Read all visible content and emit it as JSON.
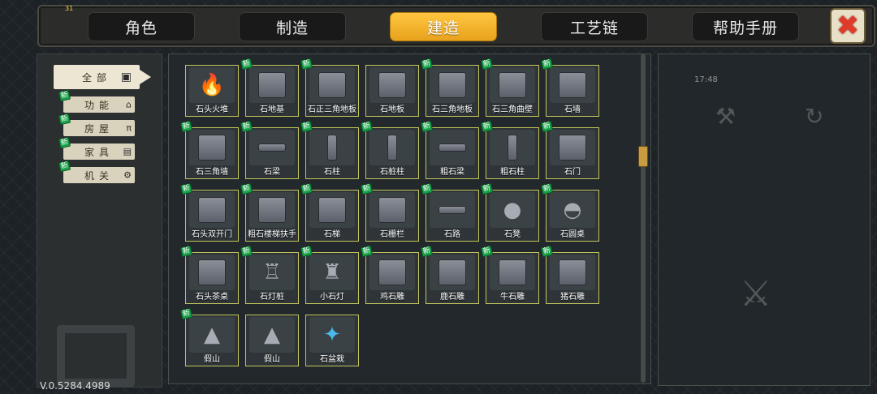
{
  "top_tabs": {
    "level": "31",
    "tabs": [
      "角色",
      "制造",
      "建造",
      "工艺链",
      "帮助手册"
    ],
    "active_index": 2
  },
  "sidebar": {
    "all_label": "全部",
    "new_badge": "新",
    "categories": [
      "功能",
      "房屋",
      "家具",
      "机关"
    ]
  },
  "items": [
    {
      "name": "石头火堆",
      "is_new": false,
      "icon": "campfire-icon"
    },
    {
      "name": "石地基",
      "is_new": true,
      "icon": "foundation-icon"
    },
    {
      "name": "石正三角地板",
      "is_new": true,
      "icon": "triangle-floor-icon"
    },
    {
      "name": "石地板",
      "is_new": false,
      "icon": "floor-icon"
    },
    {
      "name": "石三角地板",
      "is_new": true,
      "icon": "triangle-floor-icon"
    },
    {
      "name": "石三角曲壁",
      "is_new": true,
      "icon": "curved-wall-icon"
    },
    {
      "name": "石墙",
      "is_new": true,
      "icon": "wall-icon"
    },
    {
      "name": "石三角墙",
      "is_new": true,
      "icon": "triangle-wall-icon"
    },
    {
      "name": "石梁",
      "is_new": true,
      "icon": "beam-icon"
    },
    {
      "name": "石柱",
      "is_new": true,
      "icon": "pillar-icon"
    },
    {
      "name": "石桩柱",
      "is_new": true,
      "icon": "pile-pillar-icon"
    },
    {
      "name": "粗石梁",
      "is_new": true,
      "icon": "beam-icon"
    },
    {
      "name": "粗石柱",
      "is_new": true,
      "icon": "pillar-icon"
    },
    {
      "name": "石门",
      "is_new": true,
      "icon": "door-icon"
    },
    {
      "name": "石头双开门",
      "is_new": true,
      "icon": "double-door-icon"
    },
    {
      "name": "粗石楼梯扶手",
      "is_new": true,
      "icon": "handrail-icon"
    },
    {
      "name": "石梯",
      "is_new": true,
      "icon": "stairs-icon"
    },
    {
      "name": "石栅栏",
      "is_new": true,
      "icon": "fence-icon"
    },
    {
      "name": "石路",
      "is_new": true,
      "icon": "path-icon"
    },
    {
      "name": "石凳",
      "is_new": true,
      "icon": "stool-icon"
    },
    {
      "name": "石圆桌",
      "is_new": true,
      "icon": "round-table-icon"
    },
    {
      "name": "石头茶桌",
      "is_new": true,
      "icon": "tea-table-icon"
    },
    {
      "name": "石灯桩",
      "is_new": true,
      "icon": "lamp-post-icon"
    },
    {
      "name": "小石灯",
      "is_new": true,
      "icon": "small-lamp-icon"
    },
    {
      "name": "鸡石雕",
      "is_new": true,
      "icon": "chicken-statue-icon"
    },
    {
      "name": "鹿石雕",
      "is_new": true,
      "icon": "deer-statue-icon"
    },
    {
      "name": "牛石雕",
      "is_new": true,
      "icon": "cow-statue-icon"
    },
    {
      "name": "猪石雕",
      "is_new": true,
      "icon": "pig-statue-icon"
    },
    {
      "name": "假山",
      "is_new": true,
      "icon": "rockery-icon"
    },
    {
      "name": "假山",
      "is_new": false,
      "icon": "rockery-icon"
    },
    {
      "name": "石盆栽",
      "is_new": false,
      "icon": "bonsai-icon"
    }
  ],
  "version": "V.0.5284.4989",
  "colors": {
    "active_tab": "#f4b52e",
    "item_border": "#c3c65a",
    "new_badge": "#18a048",
    "close_x": "#e03a2a"
  }
}
